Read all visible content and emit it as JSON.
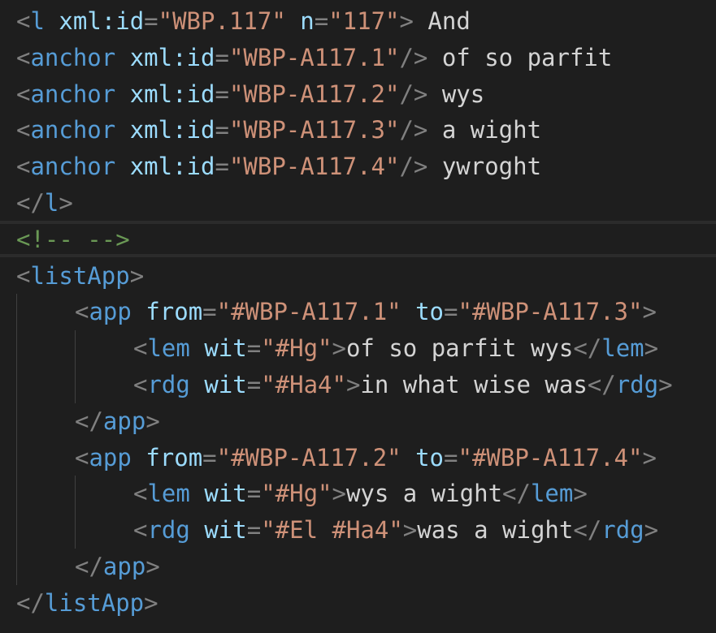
{
  "editor": {
    "lines": [
      {
        "indent": 0,
        "tokens": [
          {
            "t": "punc",
            "v": "<"
          },
          {
            "t": "tag",
            "v": "l"
          },
          {
            "t": "text",
            "v": " "
          },
          {
            "t": "attr",
            "v": "xml:id"
          },
          {
            "t": "punc",
            "v": "="
          },
          {
            "t": "str",
            "v": "\"WBP.117\""
          },
          {
            "t": "text",
            "v": " "
          },
          {
            "t": "attr",
            "v": "n"
          },
          {
            "t": "punc",
            "v": "="
          },
          {
            "t": "str",
            "v": "\"117\""
          },
          {
            "t": "punc",
            "v": ">"
          },
          {
            "t": "text",
            "v": " And"
          }
        ]
      },
      {
        "indent": 0,
        "tokens": [
          {
            "t": "punc",
            "v": "<"
          },
          {
            "t": "tag",
            "v": "anchor"
          },
          {
            "t": "text",
            "v": " "
          },
          {
            "t": "attr",
            "v": "xml:id"
          },
          {
            "t": "punc",
            "v": "="
          },
          {
            "t": "str",
            "v": "\"WBP-A117.1\""
          },
          {
            "t": "punc",
            "v": "/>"
          },
          {
            "t": "text",
            "v": " of so parfit"
          }
        ]
      },
      {
        "indent": 0,
        "tokens": [
          {
            "t": "punc",
            "v": "<"
          },
          {
            "t": "tag",
            "v": "anchor"
          },
          {
            "t": "text",
            "v": " "
          },
          {
            "t": "attr",
            "v": "xml:id"
          },
          {
            "t": "punc",
            "v": "="
          },
          {
            "t": "str",
            "v": "\"WBP-A117.2\""
          },
          {
            "t": "punc",
            "v": "/>"
          },
          {
            "t": "text",
            "v": " wys"
          }
        ]
      },
      {
        "indent": 0,
        "tokens": [
          {
            "t": "punc",
            "v": "<"
          },
          {
            "t": "tag",
            "v": "anchor"
          },
          {
            "t": "text",
            "v": " "
          },
          {
            "t": "attr",
            "v": "xml:id"
          },
          {
            "t": "punc",
            "v": "="
          },
          {
            "t": "str",
            "v": "\"WBP-A117.3\""
          },
          {
            "t": "punc",
            "v": "/>"
          },
          {
            "t": "text",
            "v": " a wight"
          }
        ]
      },
      {
        "indent": 0,
        "tokens": [
          {
            "t": "punc",
            "v": "<"
          },
          {
            "t": "tag",
            "v": "anchor"
          },
          {
            "t": "text",
            "v": " "
          },
          {
            "t": "attr",
            "v": "xml:id"
          },
          {
            "t": "punc",
            "v": "="
          },
          {
            "t": "str",
            "v": "\"WBP-A117.4\""
          },
          {
            "t": "punc",
            "v": "/>"
          },
          {
            "t": "text",
            "v": " ywroght"
          }
        ]
      },
      {
        "indent": 0,
        "tokens": [
          {
            "t": "punc",
            "v": "</"
          },
          {
            "t": "tag",
            "v": "l"
          },
          {
            "t": "punc",
            "v": ">"
          }
        ]
      },
      {
        "indent": 0,
        "tokens": [
          {
            "t": "comment",
            "v": "<!-- -->"
          }
        ]
      },
      {
        "indent": 0,
        "tokens": [
          {
            "t": "punc",
            "v": "<"
          },
          {
            "t": "tag",
            "v": "listApp"
          },
          {
            "t": "punc",
            "v": ">"
          }
        ]
      },
      {
        "indent": 1,
        "tokens": [
          {
            "t": "punc",
            "v": "<"
          },
          {
            "t": "tag",
            "v": "app"
          },
          {
            "t": "text",
            "v": " "
          },
          {
            "t": "attr",
            "v": "from"
          },
          {
            "t": "punc",
            "v": "="
          },
          {
            "t": "str",
            "v": "\"#WBP-A117.1\""
          },
          {
            "t": "text",
            "v": " "
          },
          {
            "t": "attr",
            "v": "to"
          },
          {
            "t": "punc",
            "v": "="
          },
          {
            "t": "str",
            "v": "\"#WBP-A117.3\""
          },
          {
            "t": "punc",
            "v": ">"
          }
        ]
      },
      {
        "indent": 2,
        "tokens": [
          {
            "t": "punc",
            "v": "<"
          },
          {
            "t": "tag",
            "v": "lem"
          },
          {
            "t": "text",
            "v": " "
          },
          {
            "t": "attr",
            "v": "wit"
          },
          {
            "t": "punc",
            "v": "="
          },
          {
            "t": "str",
            "v": "\"#Hg\""
          },
          {
            "t": "punc",
            "v": ">"
          },
          {
            "t": "text",
            "v": "of so parfit wys"
          },
          {
            "t": "punc",
            "v": "</"
          },
          {
            "t": "tag",
            "v": "lem"
          },
          {
            "t": "punc",
            "v": ">"
          }
        ]
      },
      {
        "indent": 2,
        "tokens": [
          {
            "t": "punc",
            "v": "<"
          },
          {
            "t": "tag",
            "v": "rdg"
          },
          {
            "t": "text",
            "v": " "
          },
          {
            "t": "attr",
            "v": "wit"
          },
          {
            "t": "punc",
            "v": "="
          },
          {
            "t": "str",
            "v": "\"#Ha4\""
          },
          {
            "t": "punc",
            "v": ">"
          },
          {
            "t": "text",
            "v": "in what wise was"
          },
          {
            "t": "punc",
            "v": "</"
          },
          {
            "t": "tag",
            "v": "rdg"
          },
          {
            "t": "punc",
            "v": ">"
          }
        ]
      },
      {
        "indent": 1,
        "tokens": [
          {
            "t": "punc",
            "v": "</"
          },
          {
            "t": "tag",
            "v": "app"
          },
          {
            "t": "punc",
            "v": ">"
          }
        ]
      },
      {
        "indent": 1,
        "tokens": [
          {
            "t": "punc",
            "v": "<"
          },
          {
            "t": "tag",
            "v": "app"
          },
          {
            "t": "text",
            "v": " "
          },
          {
            "t": "attr",
            "v": "from"
          },
          {
            "t": "punc",
            "v": "="
          },
          {
            "t": "str",
            "v": "\"#WBP-A117.2\""
          },
          {
            "t": "text",
            "v": " "
          },
          {
            "t": "attr",
            "v": "to"
          },
          {
            "t": "punc",
            "v": "="
          },
          {
            "t": "str",
            "v": "\"#WBP-A117.4\""
          },
          {
            "t": "punc",
            "v": ">"
          }
        ]
      },
      {
        "indent": 2,
        "tokens": [
          {
            "t": "punc",
            "v": "<"
          },
          {
            "t": "tag",
            "v": "lem"
          },
          {
            "t": "text",
            "v": " "
          },
          {
            "t": "attr",
            "v": "wit"
          },
          {
            "t": "punc",
            "v": "="
          },
          {
            "t": "str",
            "v": "\"#Hg\""
          },
          {
            "t": "punc",
            "v": ">"
          },
          {
            "t": "text",
            "v": "wys a wight"
          },
          {
            "t": "punc",
            "v": "</"
          },
          {
            "t": "tag",
            "v": "lem"
          },
          {
            "t": "punc",
            "v": ">"
          }
        ]
      },
      {
        "indent": 2,
        "tokens": [
          {
            "t": "punc",
            "v": "<"
          },
          {
            "t": "tag",
            "v": "rdg"
          },
          {
            "t": "text",
            "v": " "
          },
          {
            "t": "attr",
            "v": "wit"
          },
          {
            "t": "punc",
            "v": "="
          },
          {
            "t": "str",
            "v": "\"#El #Ha4\""
          },
          {
            "t": "punc",
            "v": ">"
          },
          {
            "t": "text",
            "v": "was a wight"
          },
          {
            "t": "punc",
            "v": "</"
          },
          {
            "t": "tag",
            "v": "rdg"
          },
          {
            "t": "punc",
            "v": ">"
          }
        ]
      },
      {
        "indent": 1,
        "tokens": [
          {
            "t": "punc",
            "v": "</"
          },
          {
            "t": "tag",
            "v": "app"
          },
          {
            "t": "punc",
            "v": ">"
          }
        ]
      },
      {
        "indent": 0,
        "tokens": [
          {
            "t": "punc",
            "v": "</"
          },
          {
            "t": "tag",
            "v": "listApp"
          },
          {
            "t": "punc",
            "v": ">"
          }
        ]
      }
    ]
  },
  "colors": {
    "background": "#1e1e1e",
    "punctuation": "#808080",
    "tag": "#569cd6",
    "attribute": "#9cdcfe",
    "string": "#ce9178",
    "text": "#d4d4d4",
    "comment": "#6a9955"
  }
}
